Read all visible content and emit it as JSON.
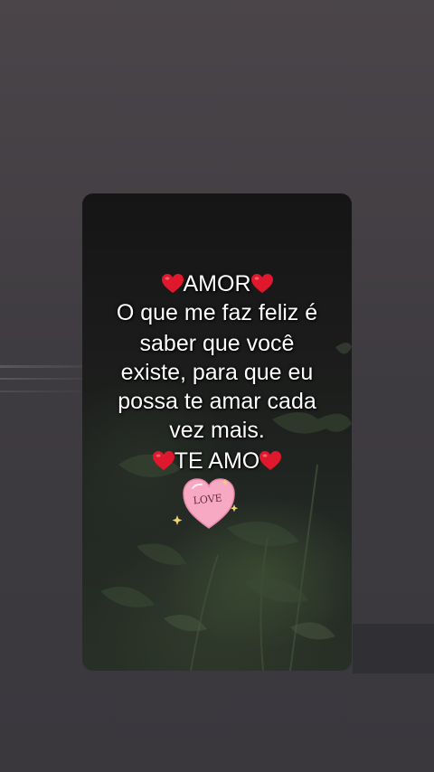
{
  "message": {
    "heading": "AMOR",
    "lines": [
      "O que me faz feliz é",
      "saber que você",
      "existe, para que eu",
      "possa te amar cada",
      "vez mais."
    ],
    "closing": "TE AMO"
  },
  "sticker": {
    "text": "LOVE",
    "icon": "love-heart-sticker"
  },
  "colors": {
    "heart": "#e0182d",
    "sticker_pink": "#f7a9c4",
    "text": "#ffffff"
  }
}
